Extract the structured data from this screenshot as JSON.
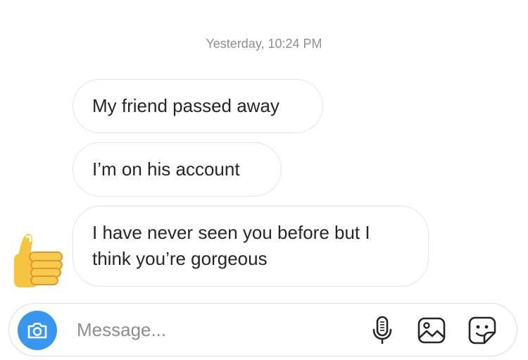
{
  "thread": {
    "timestamp": "Yesterday, 10:24 PM",
    "messages": [
      {
        "text": "My friend passed away"
      },
      {
        "text": "I’m on his account"
      },
      {
        "text": "I have never seen you before but I think you’re gorgeous"
      }
    ],
    "reaction_icon": "thumbs-up-emoji"
  },
  "composer": {
    "placeholder": "Message...",
    "icons": [
      "camera-icon",
      "microphone-icon",
      "gallery-icon",
      "sticker-icon"
    ]
  },
  "colors": {
    "accent": "#3797f0",
    "bubble_border": "#e3e3e3",
    "text": "#262626",
    "muted": "#8e8e8e"
  }
}
